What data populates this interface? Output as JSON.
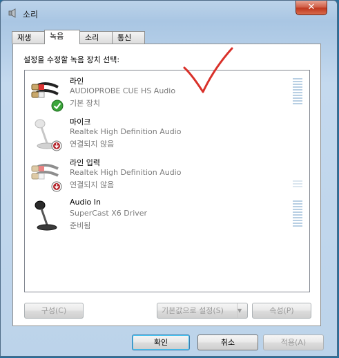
{
  "window": {
    "title": "소리"
  },
  "titlebar": {
    "close_label": "✕"
  },
  "tabs": [
    {
      "label": "재생",
      "active": false
    },
    {
      "label": "녹음",
      "active": true
    },
    {
      "label": "소리",
      "active": false
    },
    {
      "label": "통신",
      "active": false
    }
  ],
  "panel": {
    "instruction": "설정을 수정할 녹음 장치 선택:"
  },
  "devices": [
    {
      "name": "라인",
      "driver": "AUDIOPROBE CUE HS Audio",
      "status": "기본 장치",
      "icon": "line-in-cable-icon",
      "badge": "default-check-icon"
    },
    {
      "name": "마이크",
      "driver": "Realtek High Definition Audio",
      "status": "연결되지 않음",
      "icon": "microphone-icon",
      "badge": "unplugged-arrow-icon"
    },
    {
      "name": "라인 입력",
      "driver": "Realtek High Definition Audio",
      "status": "연결되지 않음",
      "icon": "line-in-cable-icon",
      "badge": "unplugged-arrow-icon"
    },
    {
      "name": "Audio In",
      "driver": "SuperCast X6 Driver",
      "status": "준비됨",
      "icon": "microphone-icon",
      "badge": ""
    }
  ],
  "buttons": {
    "configure": "구성(C)",
    "set_default": "기본값으로 설정(S)",
    "properties": "속성(P)",
    "ok": "확인",
    "cancel": "취소",
    "apply": "적용(A)"
  },
  "colors": {
    "annotation_check": "#d9312a",
    "window_frame": "#bcd3ea"
  }
}
